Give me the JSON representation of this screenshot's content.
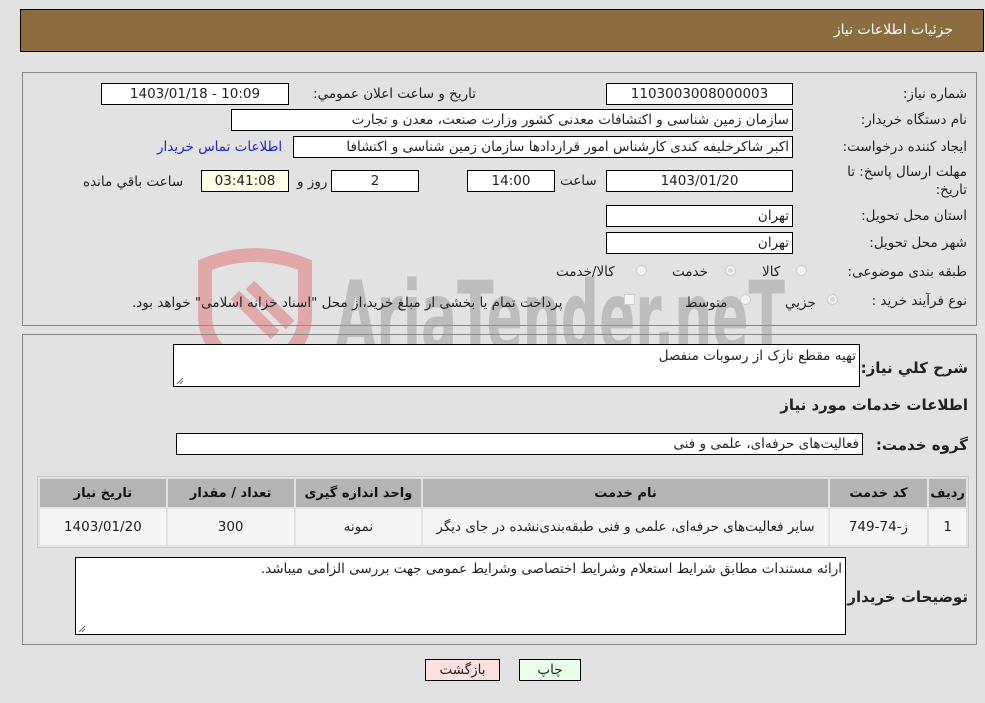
{
  "header": {
    "title": "جزئیات اطلاعات نیاز"
  },
  "form": {
    "need_number": {
      "label": "شماره نیاز:",
      "value": "1103003008000003"
    },
    "announce_datetime": {
      "label": "تاریخ و ساعت اعلان عمومي:",
      "value": "1403/01/18 - 10:09"
    },
    "buyer_org": {
      "label": "نام دستگاه خريدار:",
      "value": "سازمان زمین شناسی و اکتشافات معدنی کشور وزارت صنعت، معدن و تجارت"
    },
    "requester": {
      "label": "ايجاد کننده درخواست:",
      "value": "اکبر شاکرخلیفه کندی کارشناس امور قراردادها سازمان زمین شناسی و اکتشافا",
      "contact_link": "اطلاعات تماس خريدار"
    },
    "deadline": {
      "label_line1": "مهلت ارسال پاسخ: تا",
      "label_line2": "تاريخ:",
      "date": "1403/01/20",
      "time_label": "ساعت",
      "time": "14:00",
      "days": "2",
      "days_label": "روز و",
      "remaining": "03:41:08",
      "remaining_label": "ساعت باقي مانده"
    },
    "province": {
      "label": "استان محل تحويل:",
      "value": "تهران"
    },
    "city": {
      "label": "شهر محل تحويل:",
      "value": "تهران"
    },
    "category": {
      "label": "طبقه بندی موضوعی:",
      "options": [
        {
          "label": "کالا",
          "checked": false
        },
        {
          "label": "خدمت",
          "checked": true
        },
        {
          "label": "کالا/خدمت",
          "checked": false
        }
      ]
    },
    "purchase_type": {
      "label": "نوع فرآيند خريد :",
      "options": [
        {
          "label": "جزيي",
          "checked": true
        },
        {
          "label": "متوسط",
          "checked": false
        }
      ],
      "treasury_note": "پرداخت تمام يا بخشی از مبلغ خريد،از محل \"اسناد خزانه اسلامی\" خواهد بود."
    }
  },
  "details": {
    "description_label": "شرح کلي نياز:",
    "description_value": "تهیه مقطع نازک از رسوبات منفصل",
    "services_heading": "اطلاعات خدمات مورد نياز",
    "service_group_label": "گروه خدمت:",
    "service_group_value": "فعالیت‌های حرفه‌ای، علمی و فنی",
    "table": {
      "headers": [
        "رديف",
        "کد خدمت",
        "نام خدمت",
        "واحد اندازه گيری",
        "تعداد / مقدار",
        "تاريخ نياز"
      ],
      "rows": [
        [
          "1",
          "ز-74-749",
          "سایر فعالیت‌های حرفه‌ای، علمی و فنی طبقه‌بندی‌نشده در جای دیگر",
          "نمونه",
          "300",
          "1403/01/20"
        ]
      ]
    },
    "buyer_notes_label": "توضيحات خريدار:",
    "buyer_notes_value": "ارائه مستندات مطابق شرایط استعلام وشرایط اختصاصی وشرایط عمومی جهت بررسی الزامی میباشد."
  },
  "buttons": {
    "print": "چاپ",
    "back": "بازگشت"
  },
  "watermark": {
    "text": "AriaTender.neT"
  },
  "colors": {
    "header_bg": "#8c6d40",
    "print_bg": "#eaffea",
    "back_bg": "#ffe0e0",
    "link": "#1a27c9",
    "remaining_bg": "#ffffe8"
  }
}
